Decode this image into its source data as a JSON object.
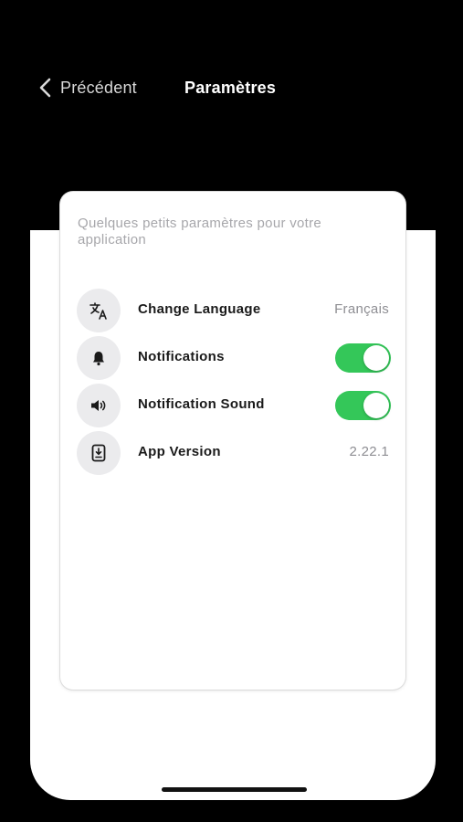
{
  "nav": {
    "back_label": "Précédent",
    "title": "Paramètres"
  },
  "card": {
    "intro": "Quelques petits paramètres pour votre application"
  },
  "settings": [
    {
      "label": "Change Language",
      "value": "Français",
      "icon": "translate-icon"
    },
    {
      "label": "Notifications",
      "toggle": true,
      "icon": "bell-icon"
    },
    {
      "label": "Notification Sound",
      "toggle": true,
      "icon": "speaker-icon"
    },
    {
      "label": "App Version",
      "value": "2.22.1",
      "icon": "tablet-download-icon"
    }
  ],
  "colors": {
    "toggle_on": "#34c759",
    "background": "#000000",
    "icon_bg": "#ebebed",
    "hint_text": "#a7a7ab"
  }
}
